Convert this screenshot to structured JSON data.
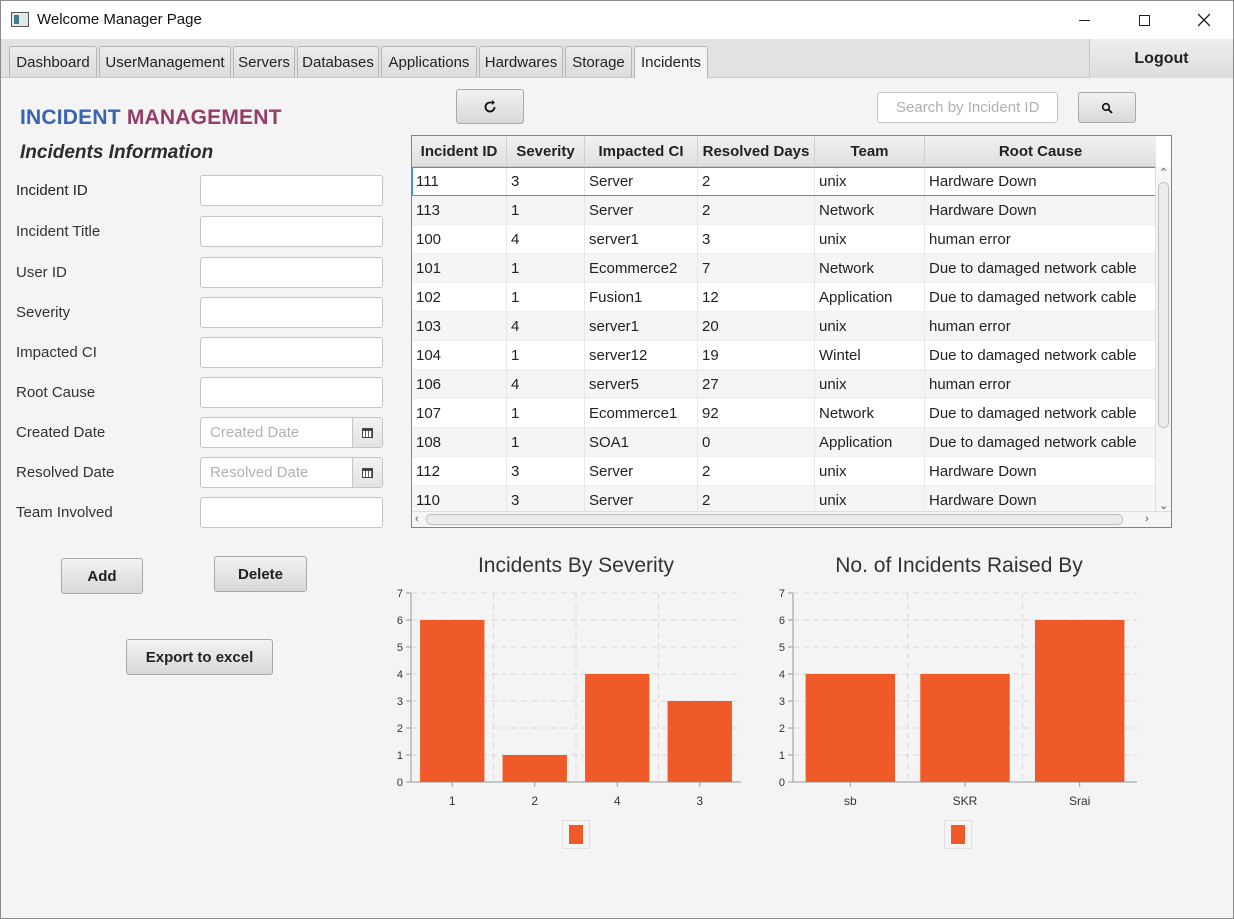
{
  "window": {
    "title": "Welcome Manager Page",
    "controls": [
      "minimize",
      "maximize",
      "close"
    ]
  },
  "tabs": [
    "Dashboard",
    "UserManagement",
    "Servers",
    "Databases",
    "Applications",
    "Hardwares",
    "Storage",
    "Incidents"
  ],
  "active_tab": "Incidents",
  "logout_label": "Logout",
  "heading": {
    "part1": "INCIDENT",
    "part2": "MANAGEMENT"
  },
  "subheading": "Incidents Information",
  "form": {
    "incident_id_label": "Incident ID",
    "incident_title_label": "Incident Title",
    "user_id_label": "User ID",
    "severity_label": "Severity",
    "impacted_ci_label": "Impacted CI",
    "root_cause_label": "Root Cause",
    "created_date_label": "Created Date",
    "created_date_placeholder": "Created Date",
    "resolved_date_label": "Resolved Date",
    "resolved_date_placeholder": "Resolved Date",
    "team_involved_label": "Team Involved",
    "add_label": "Add",
    "delete_label": "Delete",
    "export_label": "Export to excel"
  },
  "toolbar": {
    "refresh_icon": "refresh-icon",
    "search_placeholder": "Search by Incident ID",
    "search_icon": "search-icon"
  },
  "table": {
    "columns": [
      "Incident ID",
      "Severity",
      "Impacted CI",
      "Resolved Days",
      "Team",
      "Root Cause"
    ],
    "rows": [
      [
        "111",
        "3",
        "Server",
        "2",
        "unix",
        "Hardware Down"
      ],
      [
        "113",
        "1",
        "Server",
        "2",
        "Network",
        "Hardware Down"
      ],
      [
        "100",
        "4",
        "server1",
        "3",
        "unix",
        "human error"
      ],
      [
        "101",
        "1",
        "Ecommerce2",
        "7",
        "Network",
        "Due to damaged network cable"
      ],
      [
        "102",
        "1",
        "Fusion1",
        "12",
        "Application",
        "Due to damaged network cable"
      ],
      [
        "103",
        "4",
        "server1",
        "20",
        "unix",
        "human error"
      ],
      [
        "104",
        "1",
        "server12",
        "19",
        "Wintel",
        "Due to damaged network cable"
      ],
      [
        "106",
        "4",
        "server5",
        "27",
        "unix",
        "human error"
      ],
      [
        "107",
        "1",
        "Ecommerce1",
        "92",
        "Network",
        "Due to damaged network cable"
      ],
      [
        "108",
        "1",
        "SOA1",
        "0",
        "Application",
        "Due to damaged network cable"
      ],
      [
        "112",
        "3",
        "Server",
        "2",
        "unix",
        "Hardware Down"
      ],
      [
        "110",
        "3",
        "Server",
        "2",
        "unix",
        "Hardware Down"
      ]
    ]
  },
  "chart_data": [
    {
      "type": "bar",
      "title": "Incidents By Severity",
      "categories": [
        "1",
        "2",
        "4",
        "3"
      ],
      "values": [
        6,
        1,
        4,
        3
      ],
      "ylim": [
        0,
        7
      ],
      "yticks": [
        "0",
        "1",
        "2",
        "3",
        "4",
        "5",
        "6",
        "7"
      ],
      "grid": true,
      "legend": "bottom",
      "color": "#f05a28"
    },
    {
      "type": "bar",
      "title": "No. of Incidents Raised By",
      "categories": [
        "sb",
        "SKR",
        "Srai"
      ],
      "values": [
        4,
        4,
        6
      ],
      "ylim": [
        0,
        7
      ],
      "yticks": [
        "0",
        "1",
        "2",
        "3",
        "4",
        "5",
        "6",
        "7"
      ],
      "grid": true,
      "legend": "bottom",
      "color": "#f05a28"
    }
  ]
}
